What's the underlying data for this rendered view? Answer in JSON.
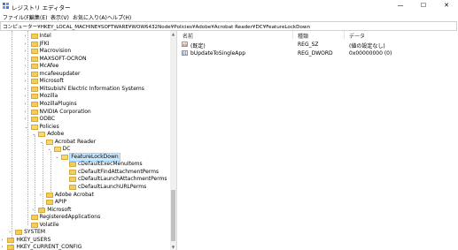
{
  "window": {
    "title": "レジストリ エディター",
    "minimize": "—",
    "maximize": "☐",
    "close": "✕"
  },
  "menu": [
    "ファイル(F)",
    "編集(E)",
    "表示(V)",
    "お気に入り(A)",
    "ヘルプ(H)"
  ],
  "address": "コンピューター¥HKEY_LOCAL_MACHINE¥SOFTWARE¥WOW6432Node¥Policies¥Adobe¥Acrobat Reader¥DC¥FeatureLockDown",
  "tree": [
    {
      "label": "Intel",
      "level": 5,
      "exp": ">"
    },
    {
      "label": "JFKI",
      "level": 5,
      "exp": ">"
    },
    {
      "label": "Macrovision",
      "level": 5,
      "exp": ">"
    },
    {
      "label": "MAXSOFT-OCRON",
      "level": 5,
      "exp": ">"
    },
    {
      "label": "McAfee",
      "level": 5,
      "exp": ">"
    },
    {
      "label": "mcafeeupdater",
      "level": 5,
      "exp": ">"
    },
    {
      "label": "Microsoft",
      "level": 5,
      "exp": ">"
    },
    {
      "label": "Mitsubishi Electric Information Systems",
      "level": 5,
      "exp": ">"
    },
    {
      "label": "Mozilla",
      "level": 5,
      "exp": ">"
    },
    {
      "label": "MozillaPlugins",
      "level": 5,
      "exp": ">"
    },
    {
      "label": "NVIDIA Corporation",
      "level": 5,
      "exp": ">"
    },
    {
      "label": "ODBC",
      "level": 5,
      "exp": ">"
    },
    {
      "label": "Policies",
      "level": 5,
      "exp": "v",
      "open": true
    },
    {
      "label": "Adobe",
      "level": 6,
      "exp": "v",
      "open": true
    },
    {
      "label": "Acrobat Reader",
      "level": 7,
      "exp": "v",
      "open": true
    },
    {
      "label": "DC",
      "level": 8,
      "exp": "v",
      "open": true
    },
    {
      "label": "FeatureLockDown",
      "level": 9,
      "exp": "v",
      "open": true,
      "selected": true
    },
    {
      "label": "cDefaultExecMenuItems",
      "level": 10,
      "exp": ""
    },
    {
      "label": "cDefaultFindAttachmentPerms",
      "level": 10,
      "exp": ""
    },
    {
      "label": "cDefaultLaunchAttachmentPerms",
      "level": 10,
      "exp": ""
    },
    {
      "label": "cDefaultLaunchURLPerms",
      "level": 10,
      "exp": ""
    },
    {
      "label": "Adobe Acrobat",
      "level": 7,
      "exp": ">"
    },
    {
      "label": "APIP",
      "level": 7,
      "exp": ""
    },
    {
      "label": "Microsoft",
      "level": 6,
      "exp": ">"
    },
    {
      "label": "RegisteredApplications",
      "level": 5,
      "exp": ""
    },
    {
      "label": "Volatile",
      "level": 5,
      "exp": ""
    },
    {
      "label": "SYSTEM",
      "level": 3,
      "exp": ">"
    },
    {
      "label": "HKEY_USERS",
      "level": 2,
      "exp": ">"
    },
    {
      "label": "HKEY_CURRENT_CONFIG",
      "level": 2,
      "exp": ">"
    }
  ],
  "columns": {
    "name": "名前",
    "type": "種類",
    "data": "データ"
  },
  "values": [
    {
      "icon": "ab",
      "kind": "sz",
      "name": "(既定)",
      "type": "REG_SZ",
      "data": "(値の設定なし)"
    },
    {
      "icon": "01",
      "kind": "dw",
      "name": "bUpdateToSingleApp",
      "type": "REG_DWORD",
      "data": "0x00000000 (0)"
    }
  ],
  "colors": {
    "selection": "#cce8ff",
    "folder": "#f4cc5b"
  }
}
